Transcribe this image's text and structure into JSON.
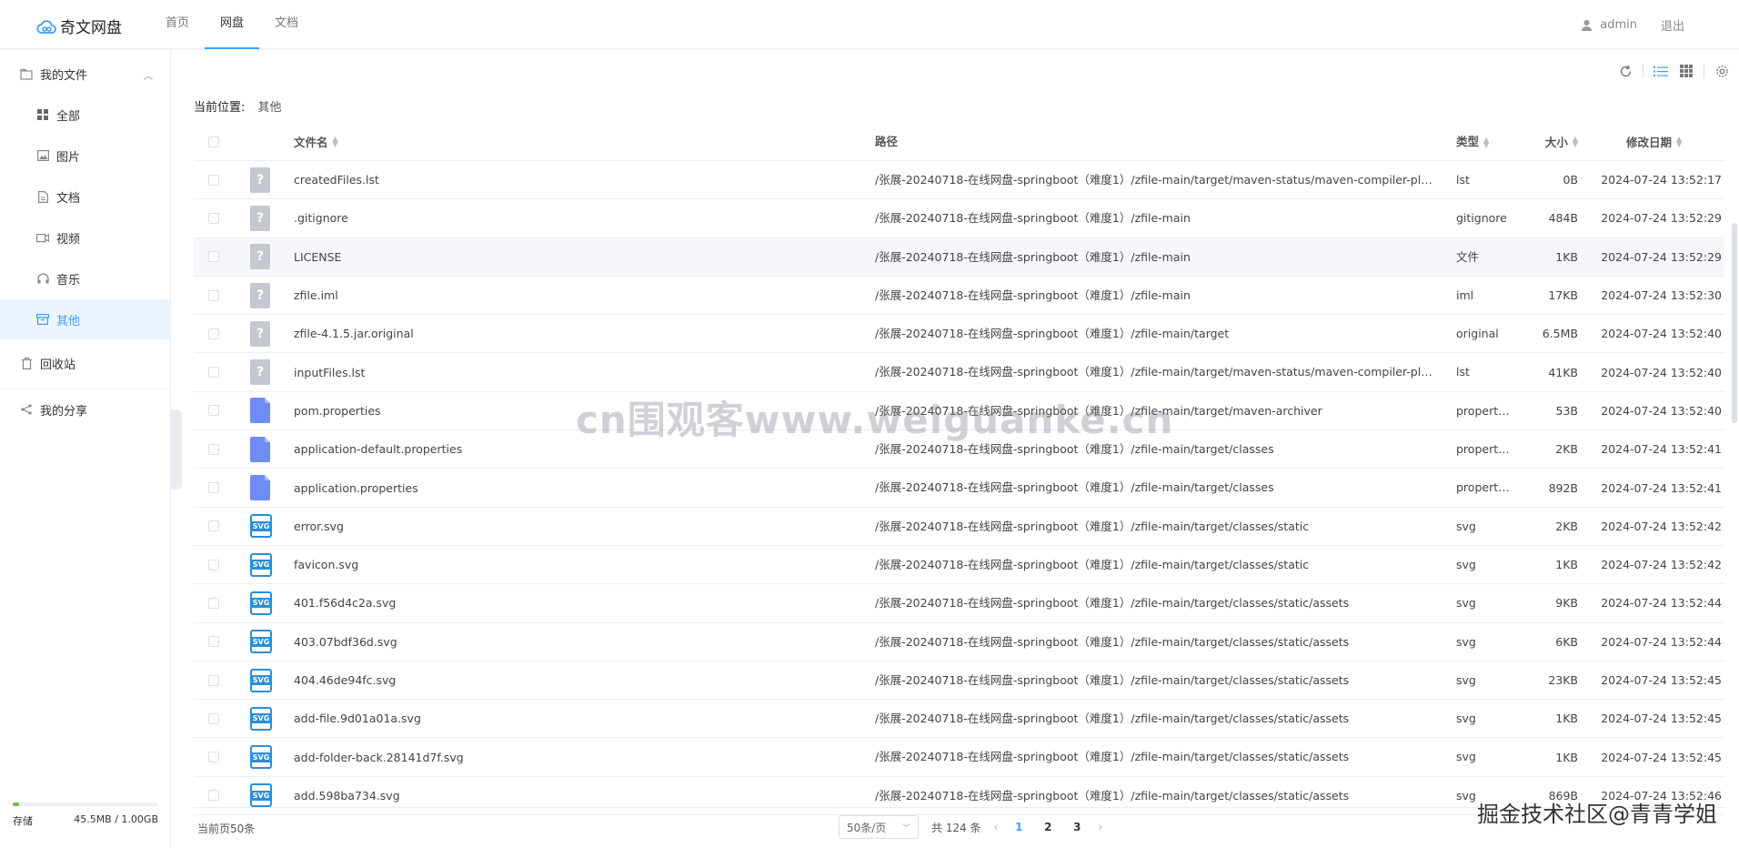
{
  "app": {
    "name": "奇文网盘"
  },
  "nav": [
    {
      "label": "首页",
      "active": false
    },
    {
      "label": "网盘",
      "active": true
    },
    {
      "label": "文档",
      "active": false
    }
  ],
  "user": {
    "name": "admin",
    "logout": "退出"
  },
  "sidebar": {
    "my_files": "我的文件",
    "items": [
      {
        "label": "全部",
        "icon": "grid-icon"
      },
      {
        "label": "图片",
        "icon": "image-icon"
      },
      {
        "label": "文档",
        "icon": "document-icon"
      },
      {
        "label": "视频",
        "icon": "video-icon"
      },
      {
        "label": "音乐",
        "icon": "headphones-icon"
      },
      {
        "label": "其他",
        "icon": "box-icon"
      }
    ],
    "recycle": "回收站",
    "share": "我的分享",
    "storage": {
      "label": "存储",
      "used": "45.5MB / 1.00GB",
      "fraction": 0.044
    }
  },
  "breadcrumb": {
    "label": "当前位置:",
    "value": "其他"
  },
  "table": {
    "headers": {
      "name": "文件名",
      "path": "路径",
      "type": "类型",
      "size": "大小",
      "time": "修改日期"
    },
    "rows": [
      {
        "icon": "unknown",
        "name": "createdFiles.lst",
        "path": "/张展-20240718-在线网盘-springboot（难度1）/zfile-main/target/maven-status/maven-compiler-plugin/compile/default-compile",
        "type": "lst",
        "size": "0B",
        "time": "2024-07-24 13:52:17"
      },
      {
        "icon": "unknown",
        "name": ".gitignore",
        "path": "/张展-20240718-在线网盘-springboot（难度1）/zfile-main",
        "type": "gitignore",
        "size": "484B",
        "time": "2024-07-24 13:52:29"
      },
      {
        "icon": "unknown",
        "name": "LICENSE",
        "path": "/张展-20240718-在线网盘-springboot（难度1）/zfile-main",
        "type": "文件",
        "size": "1KB",
        "time": "2024-07-24 13:52:29"
      },
      {
        "icon": "unknown",
        "name": "zfile.iml",
        "path": "/张展-20240718-在线网盘-springboot（难度1）/zfile-main",
        "type": "iml",
        "size": "17KB",
        "time": "2024-07-24 13:52:30"
      },
      {
        "icon": "unknown",
        "name": "zfile-4.1.5.jar.original",
        "path": "/张展-20240718-在线网盘-springboot（难度1）/zfile-main/target",
        "type": "original",
        "size": "6.5MB",
        "time": "2024-07-24 13:52:40"
      },
      {
        "icon": "unknown",
        "name": "inputFiles.lst",
        "path": "/张展-20240718-在线网盘-springboot（难度1）/zfile-main/target/maven-status/maven-compiler-plugin/compile/default-compile",
        "type": "lst",
        "size": "41KB",
        "time": "2024-07-24 13:52:40"
      },
      {
        "icon": "prop",
        "name": "pom.properties",
        "path": "/张展-20240718-在线网盘-springboot（难度1）/zfile-main/target/maven-archiver",
        "type": "properties",
        "size": "53B",
        "time": "2024-07-24 13:52:40"
      },
      {
        "icon": "prop",
        "name": "application-default.properties",
        "path": "/张展-20240718-在线网盘-springboot（难度1）/zfile-main/target/classes",
        "type": "properties",
        "size": "2KB",
        "time": "2024-07-24 13:52:41"
      },
      {
        "icon": "prop",
        "name": "application.properties",
        "path": "/张展-20240718-在线网盘-springboot（难度1）/zfile-main/target/classes",
        "type": "properties",
        "size": "892B",
        "time": "2024-07-24 13:52:41"
      },
      {
        "icon": "svg",
        "name": "error.svg",
        "path": "/张展-20240718-在线网盘-springboot（难度1）/zfile-main/target/classes/static",
        "type": "svg",
        "size": "2KB",
        "time": "2024-07-24 13:52:42"
      },
      {
        "icon": "svg",
        "name": "favicon.svg",
        "path": "/张展-20240718-在线网盘-springboot（难度1）/zfile-main/target/classes/static",
        "type": "svg",
        "size": "1KB",
        "time": "2024-07-24 13:52:42"
      },
      {
        "icon": "svg",
        "name": "401.f56d4c2a.svg",
        "path": "/张展-20240718-在线网盘-springboot（难度1）/zfile-main/target/classes/static/assets",
        "type": "svg",
        "size": "9KB",
        "time": "2024-07-24 13:52:44"
      },
      {
        "icon": "svg",
        "name": "403.07bdf36d.svg",
        "path": "/张展-20240718-在线网盘-springboot（难度1）/zfile-main/target/classes/static/assets",
        "type": "svg",
        "size": "6KB",
        "time": "2024-07-24 13:52:44"
      },
      {
        "icon": "svg",
        "name": "404.46de94fc.svg",
        "path": "/张展-20240718-在线网盘-springboot（难度1）/zfile-main/target/classes/static/assets",
        "type": "svg",
        "size": "23KB",
        "time": "2024-07-24 13:52:45"
      },
      {
        "icon": "svg",
        "name": "add-file.9d01a01a.svg",
        "path": "/张展-20240718-在线网盘-springboot（难度1）/zfile-main/target/classes/static/assets",
        "type": "svg",
        "size": "1KB",
        "time": "2024-07-24 13:52:45"
      },
      {
        "icon": "svg",
        "name": "add-folder-back.28141d7f.svg",
        "path": "/张展-20240718-在线网盘-springboot（难度1）/zfile-main/target/classes/static/assets",
        "type": "svg",
        "size": "1KB",
        "time": "2024-07-24 13:52:45"
      },
      {
        "icon": "svg",
        "name": "add.598ba734.svg",
        "path": "/张展-20240718-在线网盘-springboot（难度1）/zfile-main/target/classes/static/assets",
        "type": "svg",
        "size": "869B",
        "time": "2024-07-24 13:52:46"
      }
    ]
  },
  "footer": {
    "count": "当前页50条",
    "page_size": "50条/页",
    "total": "共 124 条",
    "pages": [
      "1",
      "2",
      "3"
    ],
    "current_page": "1"
  },
  "watermark": "cn围观客www.weiguanke.cn",
  "signature": "掘金技术社区@青青学姐",
  "colors": {
    "accent": "#409eff",
    "storage": "#67c23a",
    "svg_icon": "#2a8fd6",
    "prop_icon": "#6f8cf5"
  }
}
